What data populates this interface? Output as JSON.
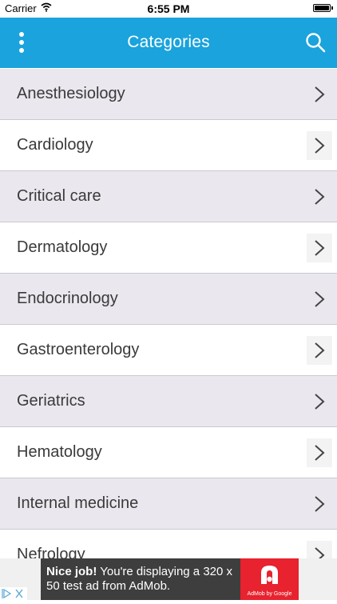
{
  "status_bar": {
    "carrier": "Carrier",
    "time": "6:55 PM"
  },
  "nav_bar": {
    "title": "Categories",
    "menu_icon": "vertical-dots-icon",
    "search_icon": "search-icon"
  },
  "categories": [
    {
      "label": "Anesthesiology"
    },
    {
      "label": "Cardiology"
    },
    {
      "label": "Critical care"
    },
    {
      "label": "Dermatology"
    },
    {
      "label": "Endocrinology"
    },
    {
      "label": "Gastroenterology"
    },
    {
      "label": "Geriatrics"
    },
    {
      "label": "Hematology"
    },
    {
      "label": "Internal medicine"
    },
    {
      "label": "Nefrology"
    }
  ],
  "ad": {
    "headline": "Nice job!",
    "body": "You're displaying a 320 x 50 test ad from AdMob.",
    "byline": "AdMob by Google"
  },
  "colors": {
    "nav_background": "#1aa3dc",
    "row_shaded": "#ebe7ee",
    "row_plain": "#ffffff",
    "ad_background": "#3e3e3e",
    "ad_logo": "#e8222e"
  }
}
